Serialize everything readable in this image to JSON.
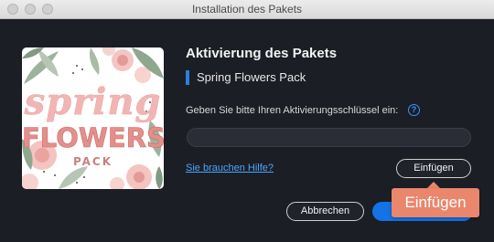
{
  "window": {
    "title": "Installation des Pakets"
  },
  "artwork": {
    "line1": "spring",
    "line2": "FLOWERS",
    "line3": "PACK"
  },
  "dialog": {
    "heading": "Aktivierung des Pakets",
    "pack_name": "Spring Flowers Pack",
    "prompt": "Geben Sie bitte Ihren Aktivierungsschlüssel ein:",
    "help_icon_glyph": "?",
    "key_input_value": "",
    "help_link": "Sie brauchen Hilfe?",
    "paste_button": "Einfügen",
    "cancel_button": "Abbrechen",
    "activate_button": ""
  },
  "tooltip": {
    "label": "Einfügen"
  },
  "colors": {
    "background": "#1c1e25",
    "accent_blue": "#1473e6",
    "link_blue": "#4aa6ff",
    "tooltip": "#e9866c"
  },
  "icons": [
    "help-icon",
    "window-close-icon",
    "window-minimize-icon",
    "window-zoom-icon"
  ]
}
